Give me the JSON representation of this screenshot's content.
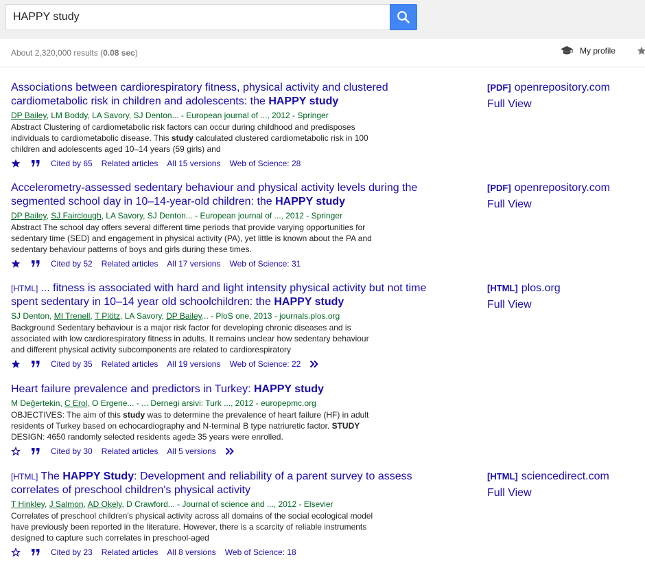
{
  "search": {
    "query": "HAPPY study"
  },
  "stats": {
    "prefix": "About 2,320,000 results (",
    "time": "0.08 sec",
    "suffix": ")"
  },
  "header": {
    "profile_label": "My profile"
  },
  "results": [
    {
      "type_tag": "",
      "title_parts": [
        {
          "text": "Associations between cardiorespiratory fitness, physical activity and clustered cardiometabolic risk in children and adolescents: the ",
          "bold": false
        },
        {
          "text": "HAPPY study",
          "bold": true
        }
      ],
      "authors": [
        {
          "text": "DP Bailey",
          "link": true
        },
        {
          "text": ", LM Boddy, LA Savory, SJ Denton... - European journal of ..., 2012 - Springer",
          "link": false
        }
      ],
      "snippet_parts": [
        {
          "text": "Abstract Clustering of cardiometabolic risk factors can occur during childhood and predisposes individuals to cardiometabolic disease. This ",
          "bold": false
        },
        {
          "text": "study",
          "bold": true
        },
        {
          "text": " calculated clustered cardiometabolic risk in 100 children and adolescents aged 10–14 years (59 girls) and",
          "bold": false
        }
      ],
      "starred": true,
      "cited_by": "Cited by 65",
      "related": "Related articles",
      "versions": "All 15 versions",
      "wos": "Web of Science: 28",
      "more": false,
      "side_tag": "[PDF]",
      "side_domain": "openrepository.com",
      "side_full": "Full View"
    },
    {
      "type_tag": "",
      "title_parts": [
        {
          "text": "Accelerometry-assessed sedentary behaviour and physical activity levels during the segmented school day in 10–14-year-old children: the ",
          "bold": false
        },
        {
          "text": "HAPPY study",
          "bold": true
        }
      ],
      "authors": [
        {
          "text": "DP Bailey",
          "link": true
        },
        {
          "text": ", ",
          "link": false
        },
        {
          "text": "SJ Fairclough",
          "link": true
        },
        {
          "text": ", LA Savory, SJ Denton... - European journal of ..., 2012 - Springer",
          "link": false
        }
      ],
      "snippet_parts": [
        {
          "text": "Abstract The school day offers several different time periods that provide varying opportunities for sedentary time (SED) and engagement in physical activity (PA), yet little is known about the PA and sedentary behaviour patterns of boys and girls during these times.",
          "bold": false
        }
      ],
      "starred": true,
      "cited_by": "Cited by 52",
      "related": "Related articles",
      "versions": "All 17 versions",
      "wos": "Web of Science: 31",
      "more": false,
      "side_tag": "[PDF]",
      "side_domain": "openrepository.com",
      "side_full": "Full View"
    },
    {
      "type_tag": "[HTML]",
      "title_parts": [
        {
          "text": "... fitness is associated with hard and light intensity physical activity but not time spent sedentary in 10–14 year old schoolchildren: the ",
          "bold": false
        },
        {
          "text": "HAPPY study",
          "bold": true
        }
      ],
      "authors": [
        {
          "text": "SJ Denton, ",
          "link": false
        },
        {
          "text": "MI Trenell",
          "link": true
        },
        {
          "text": ", ",
          "link": false
        },
        {
          "text": "T Plötz",
          "link": true
        },
        {
          "text": ", LA Savory, ",
          "link": false
        },
        {
          "text": "DP Bailey",
          "link": true
        },
        {
          "text": "... - PloS one, 2013 - journals.plos.org",
          "link": false
        }
      ],
      "snippet_parts": [
        {
          "text": "Background Sedentary behaviour is a major risk factor for developing chronic diseases and is associated with low cardiorespiratory fitness in adults. It remains unclear how sedentary behaviour and different physical activity subcomponents are related to cardiorespiratory",
          "bold": false
        }
      ],
      "starred": true,
      "cited_by": "Cited by 35",
      "related": "Related articles",
      "versions": "All 19 versions",
      "wos": "Web of Science: 22",
      "more": true,
      "side_tag": "[HTML]",
      "side_domain": "plos.org",
      "side_full": "Full View"
    },
    {
      "type_tag": "",
      "title_parts": [
        {
          "text": "Heart failure prevalence and predictors in Turkey: ",
          "bold": false
        },
        {
          "text": "HAPPY study",
          "bold": true
        }
      ],
      "authors": [
        {
          "text": "M Değertekin, ",
          "link": false
        },
        {
          "text": "C Erol",
          "link": true
        },
        {
          "text": ", O Ergene... - ... Dernegi arsivi: Turk ..., 2012 - europepmc.org",
          "link": false
        }
      ],
      "snippet_parts": [
        {
          "text": "OBJECTIVES: The aim of this ",
          "bold": false
        },
        {
          "text": "study",
          "bold": true
        },
        {
          "text": " was to determine the prevalence of heart failure (HF) in adult residents of Turkey based on echocardiography and N-terminal B type natriuretic factor. ",
          "bold": false
        },
        {
          "text": "STUDY",
          "bold": true
        },
        {
          "text": " DESIGN: 4650 randomly selected residents aged≥ 35 years were enrolled.",
          "bold": false
        }
      ],
      "starred": false,
      "cited_by": "Cited by 30",
      "related": "Related articles",
      "versions": "All 5 versions",
      "wos": "",
      "more": true,
      "side_tag": "",
      "side_domain": "",
      "side_full": ""
    },
    {
      "type_tag": "[HTML]",
      "title_parts": [
        {
          "text": "The ",
          "bold": false
        },
        {
          "text": "HAPPY Study",
          "bold": true
        },
        {
          "text": ": Development and reliability of a parent survey to assess correlates of preschool children's physical activity",
          "bold": false
        }
      ],
      "authors": [
        {
          "text": "T Hinkley",
          "link": true
        },
        {
          "text": ", ",
          "link": false
        },
        {
          "text": "J Salmon",
          "link": true
        },
        {
          "text": ", ",
          "link": false
        },
        {
          "text": "AD Okely",
          "link": true
        },
        {
          "text": ", D Crawford... - Journal of science and ..., 2012 - Elsevier",
          "link": false
        }
      ],
      "snippet_parts": [
        {
          "text": "Correlates of preschool children's physical activity across all domains of the social ecological model have previously been reported in the literature. However, there is a scarcity of reliable instruments designed to capture such correlates in preschool-aged",
          "bold": false
        }
      ],
      "starred": false,
      "cited_by": "Cited by 23",
      "related": "Related articles",
      "versions": "All 8 versions",
      "wos": "Web of Science: 18",
      "more": false,
      "side_tag": "[HTML]",
      "side_domain": "sciencedirect.com",
      "side_full": "Full View"
    }
  ],
  "colors": {
    "link": "#1a0dab",
    "author_green": "#006621",
    "search_blue": "#4285f4",
    "header_bg": "#f1f1f1"
  },
  "icons": {
    "search": "search-icon",
    "profile": "mortarboard-icon",
    "library": "star-icon",
    "save": "star-icon",
    "cite": "quote-icon",
    "more": "double-chevron-icon"
  }
}
